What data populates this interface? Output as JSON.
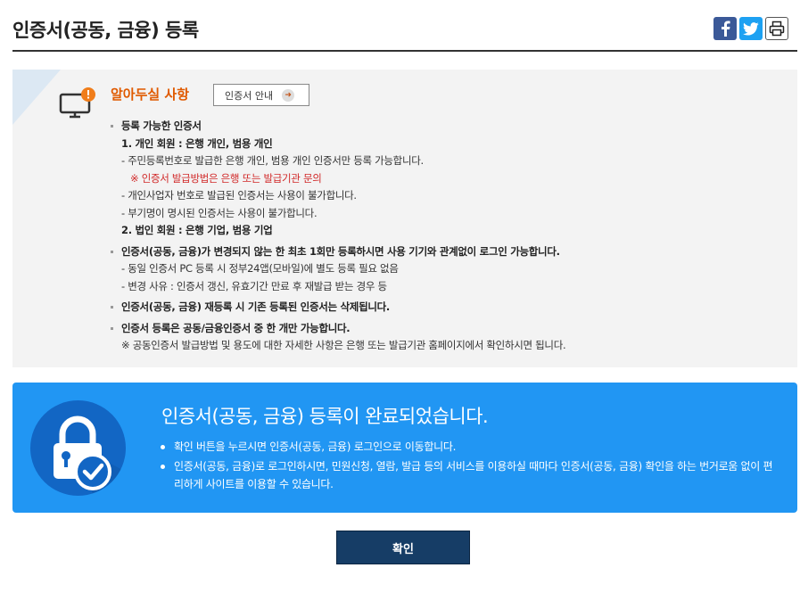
{
  "header": {
    "title": "인증서(공동, 금융) 등록",
    "share": {
      "facebook_icon": "facebook-icon",
      "twitter_icon": "twitter-icon",
      "print_icon": "print-icon"
    }
  },
  "notice": {
    "title": "알아두실 사항",
    "guide_button": "인증서 안내",
    "icon": "monitor-alert-icon",
    "items": [
      {
        "head": "등록 가능한 인증서",
        "lines": [
          {
            "text": "1. 개인 회원 : 은행 개인, 범용 개인",
            "style": "b"
          },
          {
            "text": "- 주민등록번호로 발급한 은행 개인, 범용 개인 인증서만 등록 가능합니다.",
            "style": "n"
          },
          {
            "text": "※ 인증서 발급방법은 은행 또는 발급기관 문의",
            "style": "red"
          },
          {
            "text": "- 개인사업자 번호로 발급된 인증서는 사용이 불가합니다.",
            "style": "n"
          },
          {
            "text": "- 부기명이 명시된 인증서는 사용이 불가합니다.",
            "style": "n"
          },
          {
            "text": "2. 법인 회원 : 은행 기업, 범용 기업",
            "style": "b"
          }
        ]
      },
      {
        "head": "인증서(공동, 금융)가 변경되지 않는 한 최초 1회만 등록하시면 사용 기기와 관계없이 로그인 가능합니다.",
        "lines": [
          {
            "text": "- 동일 인증서 PC 등록 시 정부24앱(모바일)에 별도 등록 필요 없음",
            "style": "n"
          },
          {
            "text": "- 변경 사유 : 인증서 갱신, 유효기간 만료 후 재발급 받는 경우 등",
            "style": "n"
          }
        ]
      },
      {
        "head": "인증서(공동, 금융) 재등록 시 기존 등록된 인증서는 삭제됩니다.",
        "lines": []
      },
      {
        "head": "인증서 등록은 공동/금융인증서 중 한 개만 가능합니다.",
        "lines": [
          {
            "text": "※ 공동인증서 발급방법 및 용도에 대한 자세한 사항은 은행 또는 발급기관 홈페이지에서 확인하시면 됩니다.",
            "style": "n"
          }
        ]
      }
    ]
  },
  "complete": {
    "icon": "lock-check-icon",
    "title": "인증서(공동, 금융) 등록이 완료되었습니다.",
    "items": [
      "확인 버튼을 누르시면 인증서(공동, 금융) 로그인으로 이동합니다.",
      "인증서(공동, 금융)로 로그인하시면, 민원신청, 열람, 발급 등의 서비스를 이용하실 때마다 인증서(공동, 금융) 확인을 하는 번거로움 없이 편리하게 사이트를 이용할 수 있습니다."
    ]
  },
  "confirm_button": "확인",
  "colors": {
    "accent": "#2196f3",
    "button": "#163d66",
    "notice_title": "#e05a00",
    "warning": "#d12a2a"
  }
}
